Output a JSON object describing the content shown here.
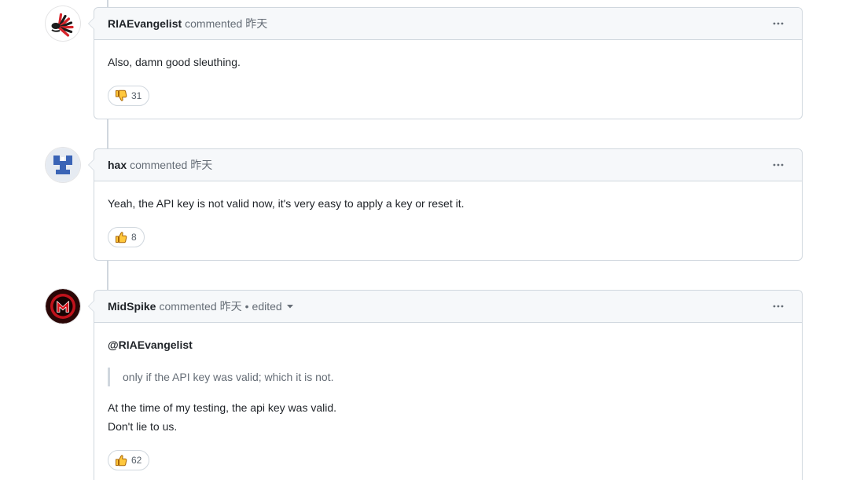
{
  "colors": {
    "border": "#d0d7de",
    "header_bg": "#f6f8fa",
    "text": "#1f2328",
    "muted": "#656d76",
    "reaction_emoji": "#ffc83d"
  },
  "icons": {
    "more": "kebab-horizontal-icon",
    "edited_menu": "caret-down-icon"
  },
  "comments": [
    {
      "author": "RIAEvangelist",
      "action": "commented",
      "time": "昨天",
      "text": "Also, damn good sleuthing.",
      "reaction_icon": "thumbs-down-icon",
      "reaction_count": "31"
    },
    {
      "author": "hax",
      "action": "commented",
      "time": "昨天",
      "text": "Yeah, the API key is not valid now, it's very easy to apply a key or reset it.",
      "reaction_icon": "thumbs-up-icon",
      "reaction_count": "8"
    },
    {
      "author": "MidSpike",
      "action": "commented",
      "time": "昨天",
      "separator": "•",
      "edited_label": "edited",
      "mention": "@RIAEvangelist",
      "quote": "only if the API key was valid; which it is not.",
      "lines": [
        "At the time of my testing, the api key was valid.",
        "Don't lie to us."
      ],
      "reaction_icon": "thumbs-up-icon",
      "reaction_count": "62"
    }
  ]
}
